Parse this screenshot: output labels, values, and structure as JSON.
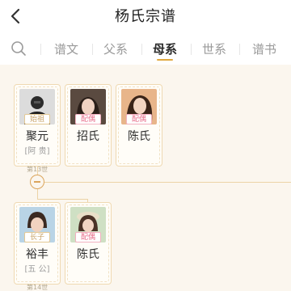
{
  "header": {
    "title": "杨氏宗谱"
  },
  "tabs": {
    "search_icon": "search-icon",
    "items": [
      {
        "label": "谱文",
        "active": false
      },
      {
        "label": "父系",
        "active": false
      },
      {
        "label": "母系",
        "active": true
      },
      {
        "label": "世系",
        "active": false
      },
      {
        "label": "谱书",
        "active": false
      }
    ],
    "accent_color": "#e0a83f"
  },
  "tree": {
    "gen_13_label": "第13世",
    "gen_14_label": "第14世",
    "row1": [
      {
        "badge": "始祖",
        "name": "聚元",
        "subname": "[阿 贵]"
      },
      {
        "badge": "配偶",
        "name": "招氏",
        "subname": ""
      },
      {
        "badge": "配偶",
        "name": "陈氏",
        "subname": ""
      }
    ],
    "row2": [
      {
        "badge": "长子",
        "name": "裕丰",
        "subname": "[五 公]"
      },
      {
        "badge": "配偶",
        "name": "陈氏",
        "subname": ""
      }
    ]
  }
}
